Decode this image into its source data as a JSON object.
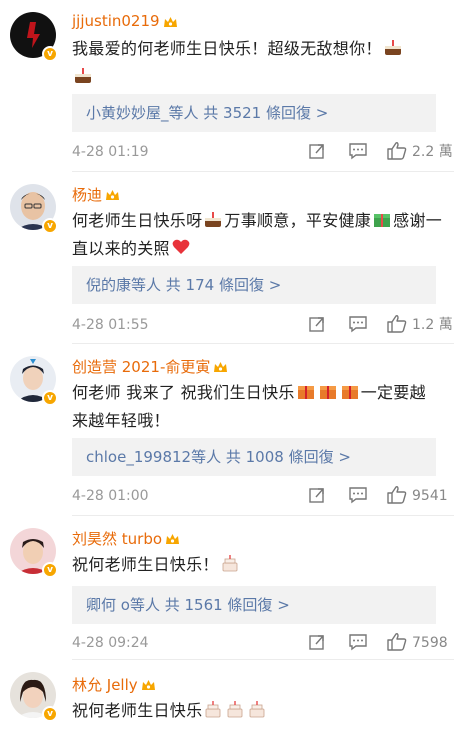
{
  "comments": [
    {
      "username": "jjjustin0219",
      "text_parts": [
        "我最爱的何老师生日快乐！超级无敌想你！",
        "🎂",
        "",
        "🎂"
      ],
      "reply": {
        "names": "小黄妙妙屋_",
        "rest": "等人 共 3521 條回復 >"
      },
      "time": "4-28 01:19",
      "likes": "2.2 萬"
    },
    {
      "username": "杨迪",
      "text_parts": [
        "何老师生日快乐呀",
        "🎂",
        "万事顺意，平安健康",
        "🎁",
        "感谢一直以来的关照",
        "❤"
      ],
      "reply": {
        "names": "倪的康",
        "rest": "等人 共 174 條回復 >"
      },
      "time": "4-28 01:55",
      "likes": "1.2 萬"
    },
    {
      "username": "创造营 2021-俞更寅",
      "text_parts": [
        "何老师 我来了 祝我们生日快乐",
        "🎁🎁🎁",
        "一定要越来越年轻哦！"
      ],
      "reply": {
        "names": "chloe_199812",
        "rest": "等人 共 1008 條回復 >"
      },
      "time": "4-28 01:00",
      "likes": "9541"
    },
    {
      "username": "刘昊然 turbo",
      "text_parts": [
        "祝何老师生日快乐！",
        "🎂"
      ],
      "reply": {
        "names": "卿何 o",
        "rest": "等人 共 1561 條回復 >"
      },
      "time": "4-28 09:24",
      "likes": "7598"
    },
    {
      "username": "林允 Jelly",
      "text_parts": [
        "祝何老师生日快乐",
        "🎂🎂🎂"
      ]
    }
  ],
  "icons": {
    "badge": "verified-v-badge-icon",
    "crown": "crown-icon",
    "share": "share-icon",
    "comment": "comment-icon",
    "like": "thumbs-up-icon"
  },
  "colors": {
    "username": "#e86b0a",
    "reply_link": "#5b79a8",
    "badge": "#f7a600"
  }
}
